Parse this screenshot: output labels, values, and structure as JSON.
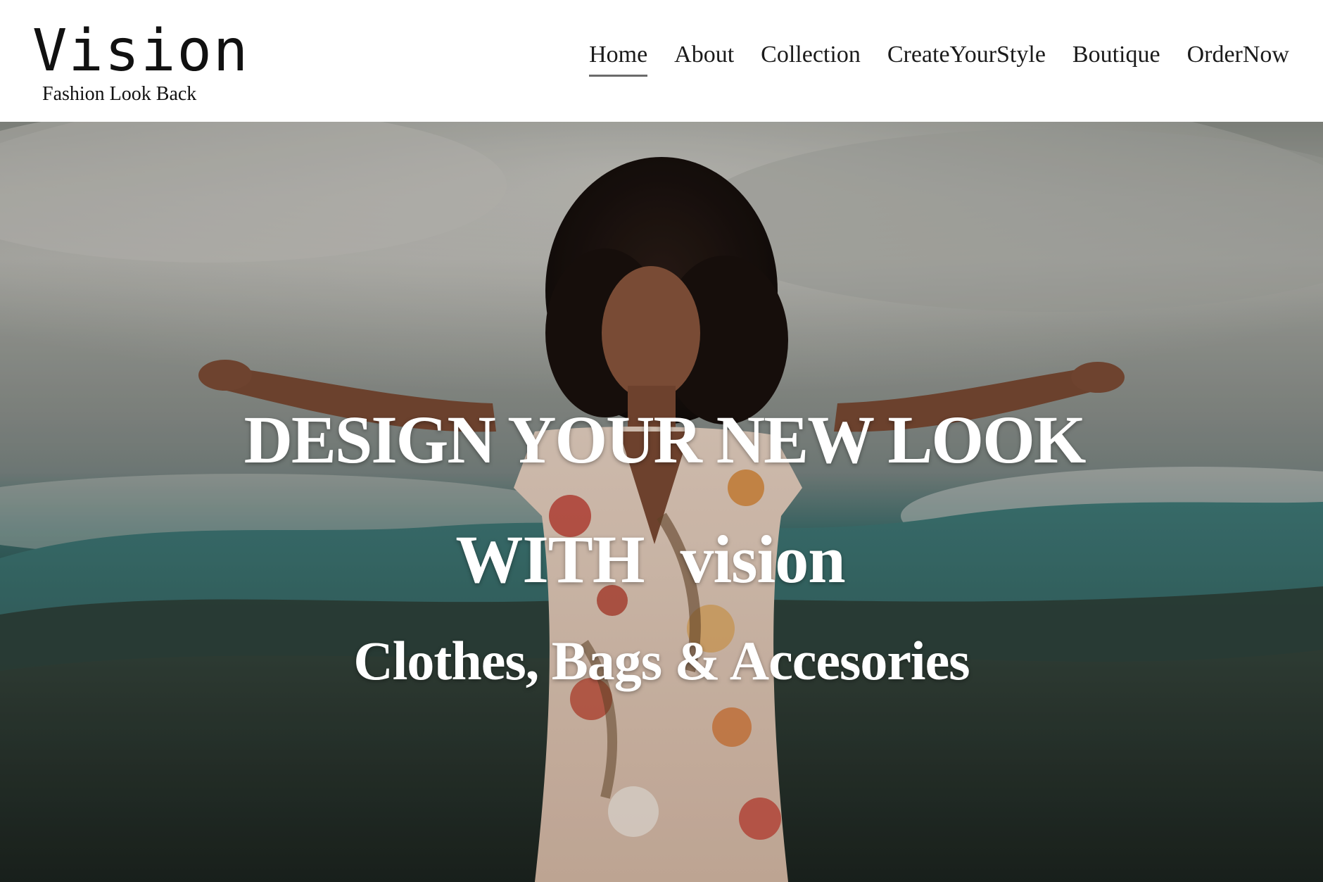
{
  "brand": {
    "title": "Vision",
    "tagline": "Fashion Look Back"
  },
  "nav": {
    "items": [
      {
        "label": "Home",
        "active": true
      },
      {
        "label": "About",
        "active": false
      },
      {
        "label": "Collection",
        "active": false
      },
      {
        "label": "CreateYourStyle",
        "active": false
      },
      {
        "label": "Boutique",
        "active": false
      },
      {
        "label": "OrderNow",
        "active": false
      }
    ]
  },
  "hero": {
    "headline_line1": "DESIGN YOUR NEW LOOK",
    "headline_line2": "WITH vision",
    "subheadline": "Clothes, Bags & Accesories"
  },
  "colors": {
    "header_background": "#ffffff",
    "nav_text": "#1b1b1b",
    "active_underline": "#6b6b6b",
    "hero_text": "#ffffff",
    "sky": "#b4b4ae",
    "hills_teal": "#2f5754",
    "ground_dark": "#1f2823"
  }
}
